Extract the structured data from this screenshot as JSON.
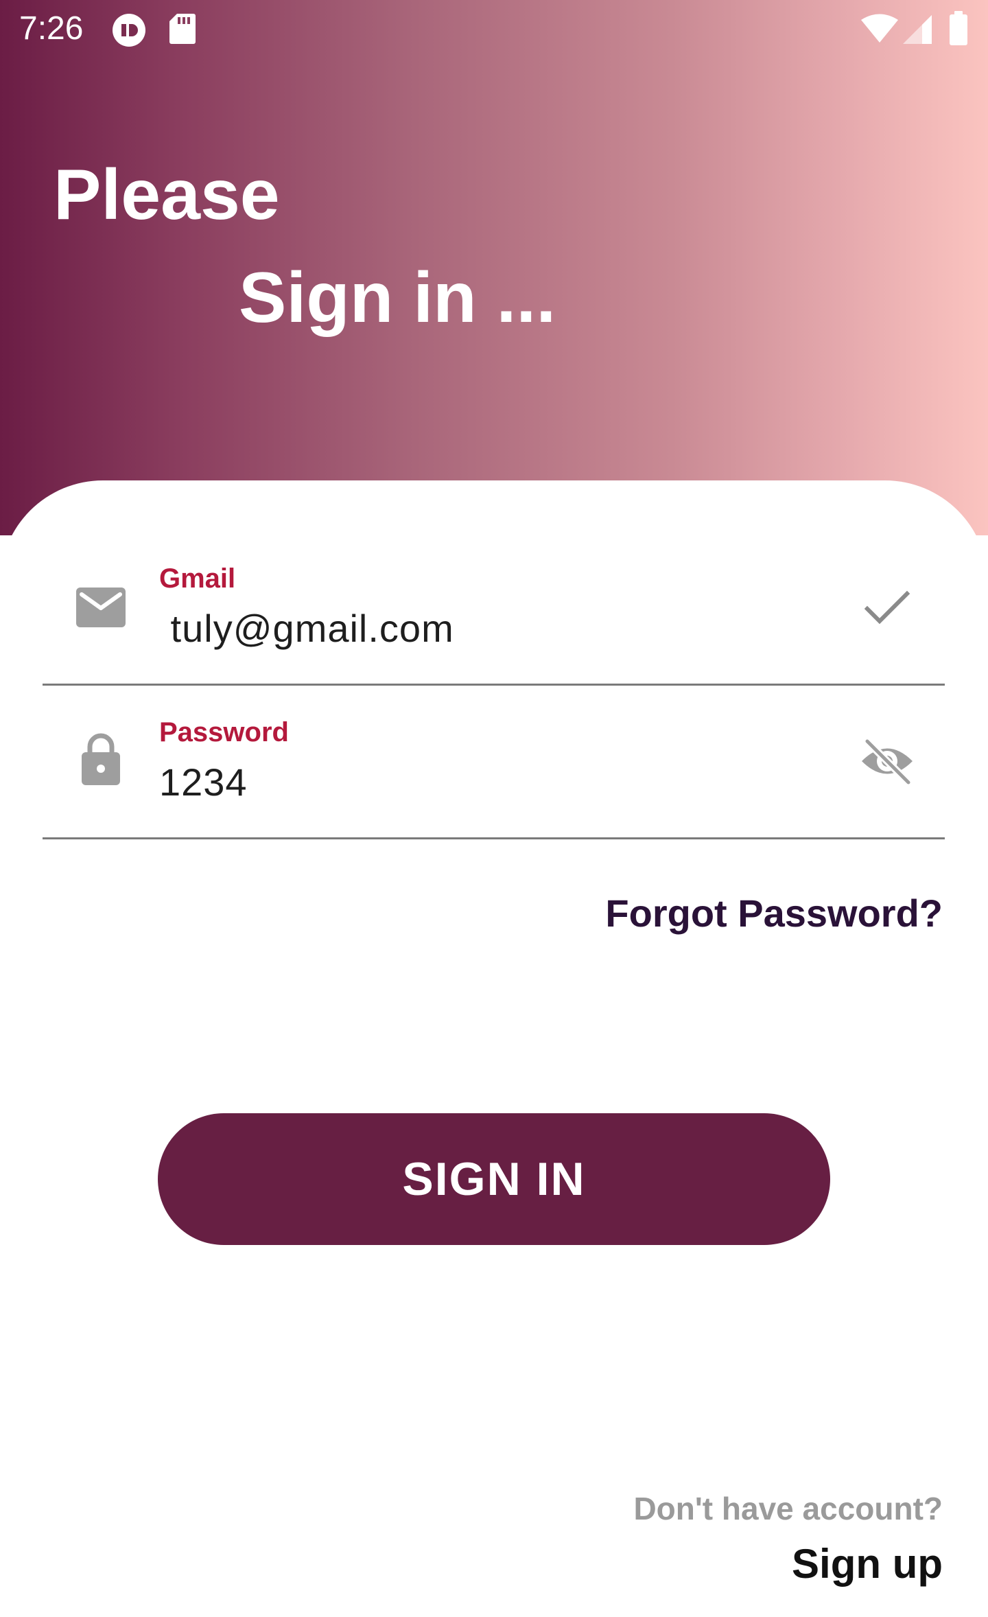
{
  "status_bar": {
    "time": "7:26",
    "icons": [
      "notification-app-icon",
      "sd-card-icon",
      "wifi-icon",
      "cell-signal-icon",
      "battery-icon"
    ]
  },
  "header": {
    "line1": "Please",
    "line2": "Sign in ..."
  },
  "form": {
    "email": {
      "label": "Gmail",
      "value": " tuly@gmail.com",
      "icon": "mail-icon",
      "status_icon": "check-icon"
    },
    "password": {
      "label": "Password",
      "value": "1234",
      "icon": "lock-icon",
      "toggle_icon": "visibility-off-icon"
    },
    "forgot_password": "Forgot Password?",
    "submit_label": "SIGN IN"
  },
  "footer": {
    "prompt": "Don't have account?",
    "signup_label": "Sign up"
  },
  "colors": {
    "gradient_start": "#6b1d45",
    "gradient_end": "#fbc4c0",
    "accent": "#b4193c",
    "button": "#671f43",
    "link": "#2a1238"
  }
}
